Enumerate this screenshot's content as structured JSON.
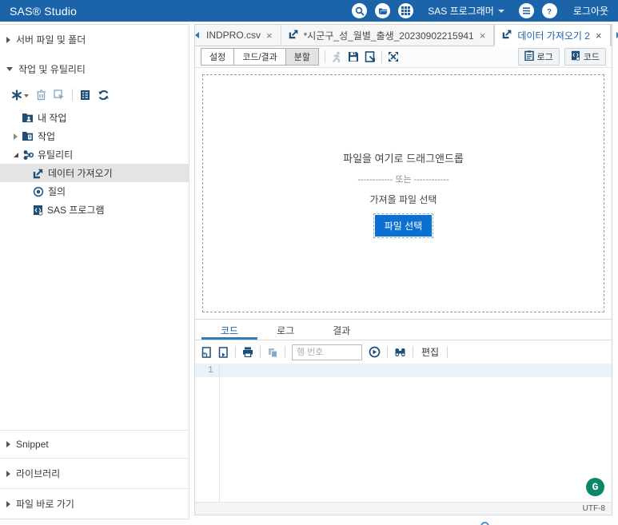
{
  "header": {
    "title": "SAS® Studio",
    "persona": "SAS 프로그래머",
    "logout": "로그아웃"
  },
  "sidebar": {
    "section_server_files": "서버 파일 및 폴더",
    "section_tasks_utils": "작업 및 유틸리티",
    "tree": {
      "my_tasks": "내 작업",
      "tasks": "작업",
      "utilities": "유틸리티",
      "import_data": "데이터 가져오기",
      "query": "질의",
      "sas_program": "SAS 프로그램"
    },
    "section_snippet": "Snippet",
    "section_libraries": "라이브러리",
    "section_file_shortcuts": "파일 바로 가기"
  },
  "tabs": {
    "tab1": "INDPRO.csv",
    "tab2": "*시군구_성_월별_출생_20230902215941",
    "tab3": "데이터 가져오기 2",
    "close": "×"
  },
  "toolbar": {
    "settings": "설정",
    "code_results": "코드/결과",
    "split": "분할",
    "split_active": true,
    "log": "로그",
    "code": "코드"
  },
  "dropzone": {
    "drag_text": "파일을 여기로 드래그앤드롭",
    "or_text": "------------ 또는 ------------",
    "select_text": "가져올 파일 선택",
    "button": "파일 선택"
  },
  "bottom": {
    "tab_code": "코드",
    "tab_log": "로그",
    "tab_results": "결과",
    "line_placeholder": "행 번호",
    "edit": "편집",
    "line1": "1",
    "encoding": "UTF-8",
    "grammarly": "G"
  },
  "icons": {
    "header": [
      "search-icon",
      "folder-open-icon",
      "apps-grid-icon",
      "list-menu-icon",
      "help-icon"
    ],
    "sidebar_toolbar": [
      "new-item-icon",
      "delete-icon",
      "select-icon",
      "properties-icon",
      "refresh-icon"
    ],
    "tree": [
      "my-tasks-folder-icon",
      "tasks-folder-icon",
      "utilities-nodes-icon",
      "import-data-icon",
      "query-icon",
      "sas-program-icon"
    ],
    "main_toolbar": [
      "run-icon",
      "save-icon",
      "save-as-icon",
      "maximize-icon",
      "log-clipboard-icon",
      "code-page-icon"
    ],
    "code_toolbar": [
      "open-log-doc-icon",
      "export-doc-icon",
      "print-icon",
      "copy-icon",
      "goto-line-icon",
      "find-icon"
    ]
  },
  "colors": {
    "header_bg": "#1c64a9",
    "accent_blue": "#1b63a8",
    "icon_navy": "#1c4e78",
    "selection_gray": "#e4e4e4",
    "primary_button": "#0c70d2",
    "grammarly_green": "#0d8568",
    "editor_line_highlight": "#e7f2fb"
  }
}
